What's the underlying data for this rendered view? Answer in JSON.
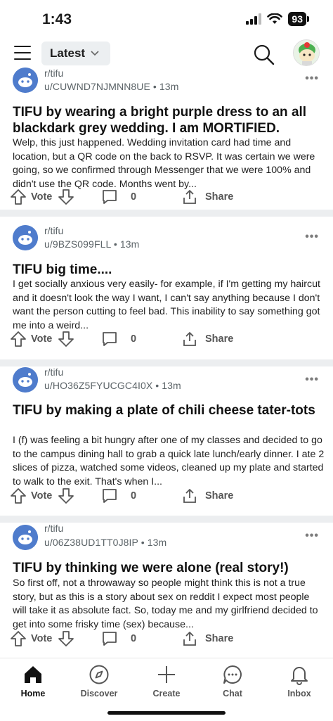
{
  "status": {
    "time": "1:43",
    "battery": "93"
  },
  "header": {
    "feed_label": "Latest"
  },
  "posts": [
    {
      "subreddit": "r/tifu",
      "meta": "u/CUWND7NJMNN8UE • 13m",
      "title": "TIFU by wearing a bright purple dress to an all blackdark grey wedding. I am MORTIFIED.",
      "body": "Welp, this just happened. Wedding invitation card had time and location, but a QR code on the back to RSVP. It was certain we were going, so we confirmed through Messenger that we were 100% and didn't use the QR code. Months went by...",
      "vote_label": "Vote",
      "comments": "0",
      "share_label": "Share"
    },
    {
      "subreddit": "r/tifu",
      "meta": "u/9BZS099FLL • 13m",
      "title": "TIFU big time....",
      "body": "I get socially anxious very easily- for example, if I'm getting my haircut and it doesn't look the way I want, I can't say anything because I don't want the  person cutting to feel bad. This inability to say something got me into a weird...",
      "vote_label": "Vote",
      "comments": "0",
      "share_label": "Share"
    },
    {
      "subreddit": "r/tifu",
      "meta": "u/HO36Z5FYUCGC4I0X • 13m",
      "title": "TIFU by making a plate of chili cheese tater-tots",
      "body": "I (f) was feeling a bit hungry after one of my classes and decided to go to the campus dining hall to grab a quick late lunch/early dinner. I ate 2 slices of pizza, watched some videos, cleaned up my plate and started to walk to the exit. That's when I...",
      "vote_label": "Vote",
      "comments": "0",
      "share_label": "Share"
    },
    {
      "subreddit": "r/tifu",
      "meta": "u/06Z38UD1TT0J8IP • 13m",
      "title": "TIFU by thinking we were alone (real story!)",
      "body": "So first off, not a throwaway so people might think this is not a true story, but as this is a story about sex on reddit I expect most people will take it as absolute fact. So, today me and my girlfriend decided to get into some frisky time (sex) because...",
      "vote_label": "Vote",
      "comments": "0",
      "share_label": "Share"
    }
  ],
  "nav": {
    "home": "Home",
    "discover": "Discover",
    "create": "Create",
    "chat": "Chat",
    "inbox": "Inbox"
  }
}
